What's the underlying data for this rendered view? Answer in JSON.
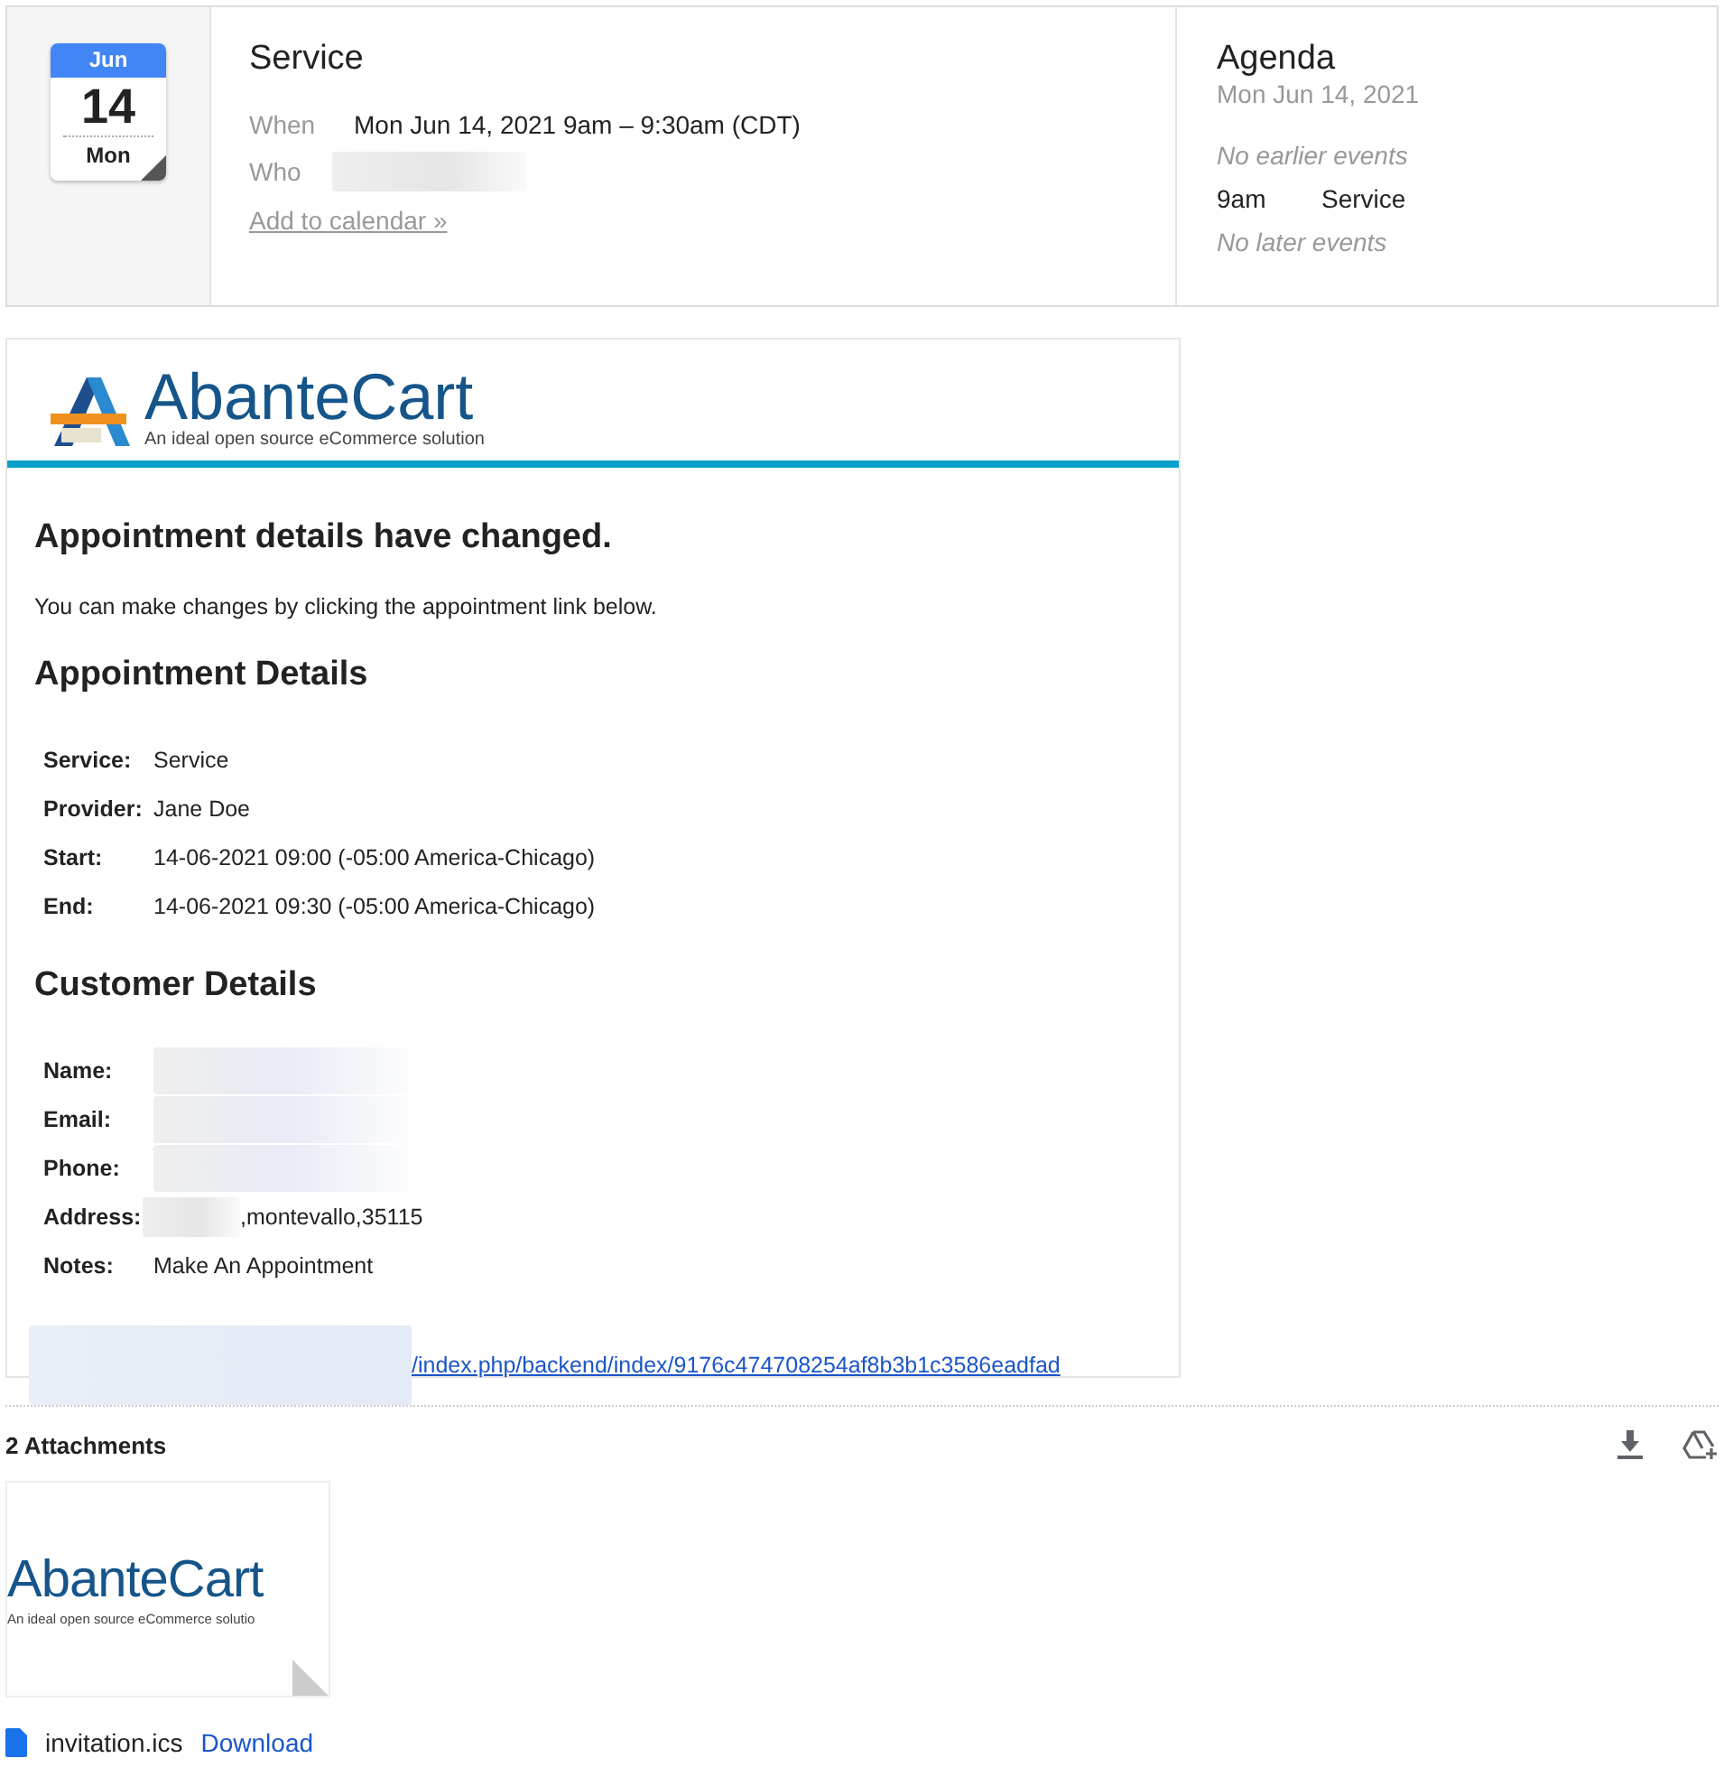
{
  "event": {
    "calendar_icon": {
      "month": "Jun",
      "day": "14",
      "weekday": "Mon"
    },
    "title": "Service",
    "when_label": "When",
    "when_value": "Mon Jun 14, 2021 9am – 9:30am (CDT)",
    "who_label": "Who",
    "who_redacted": true,
    "add_link": "Add to calendar »"
  },
  "agenda": {
    "title": "Agenda",
    "date": "Mon Jun 14, 2021",
    "before": "No earlier events",
    "items": [
      {
        "time": "9am",
        "title": "Service"
      }
    ],
    "after": "No later events"
  },
  "email": {
    "logo": {
      "name": "AbanteCart",
      "tagline": "An ideal open source eCommerce solution"
    },
    "heading": "Appointment details have changed.",
    "intro": "You can make changes by clicking the appointment link below.",
    "appointment_heading": "Appointment Details",
    "appointment_rows": [
      {
        "label": "Service:",
        "value": "Service"
      },
      {
        "label": "Provider:",
        "value": "Jane Doe"
      },
      {
        "label": "Start:",
        "value": "14-06-2021 09:00 (-05:00 America-Chicago)"
      },
      {
        "label": "End:",
        "value": "14-06-2021 09:30 (-05:00 America-Chicago)"
      }
    ],
    "customer_heading": "Customer Details",
    "customer_rows": [
      {
        "label": "Name:",
        "value": "",
        "redacted": true
      },
      {
        "label": "Email:",
        "value": "",
        "redacted": true
      },
      {
        "label": "Phone:",
        "value": "",
        "redacted": true
      },
      {
        "label": "Address:",
        "value": ",montevallo,35115",
        "redacted": true
      },
      {
        "label": "Notes:",
        "value": "Make An Appointment",
        "redacted": false
      }
    ],
    "link": "/index.php/backend/index/9176c474708254af8b3b1c3586eadfad"
  },
  "attachments": {
    "title": "2 Attachments",
    "thumbnail": {
      "name": "AbanteCart",
      "tagline": "An ideal open source eCommerce solutio"
    },
    "file_name": "invitation.ics",
    "download": "Download"
  }
}
